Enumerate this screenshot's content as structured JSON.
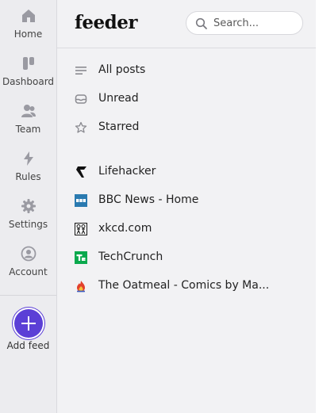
{
  "rail": {
    "items": [
      {
        "label": "Home",
        "icon": "home-icon"
      },
      {
        "label": "Dashboard",
        "icon": "dashboard-icon"
      },
      {
        "label": "Team",
        "icon": "team-icon"
      },
      {
        "label": "Rules",
        "icon": "lightning-icon"
      },
      {
        "label": "Settings",
        "icon": "gear-icon"
      },
      {
        "label": "Account",
        "icon": "account-icon"
      }
    ],
    "add_label": "Add feed"
  },
  "header": {
    "logo": "feeder",
    "search_placeholder": "Search..."
  },
  "nav": [
    {
      "label": "All posts",
      "icon": "list-icon"
    },
    {
      "label": "Unread",
      "icon": "inbox-icon"
    },
    {
      "label": "Starred",
      "icon": "star-icon"
    }
  ],
  "feeds": [
    {
      "label": "Lifehacker",
      "icon": "lifehacker-logo-icon"
    },
    {
      "label": "BBC News - Home",
      "icon": "bbc-logo-icon"
    },
    {
      "label": "xkcd.com",
      "icon": "xkcd-logo-icon"
    },
    {
      "label": "TechCrunch",
      "icon": "techcrunch-logo-icon"
    },
    {
      "label": "The Oatmeal - Comics by Ma...",
      "icon": "oatmeal-logo-icon"
    }
  ],
  "colors": {
    "accent": "#5b3fd6",
    "rail_bg": "#ececef",
    "main_bg": "#f2f2f4"
  }
}
